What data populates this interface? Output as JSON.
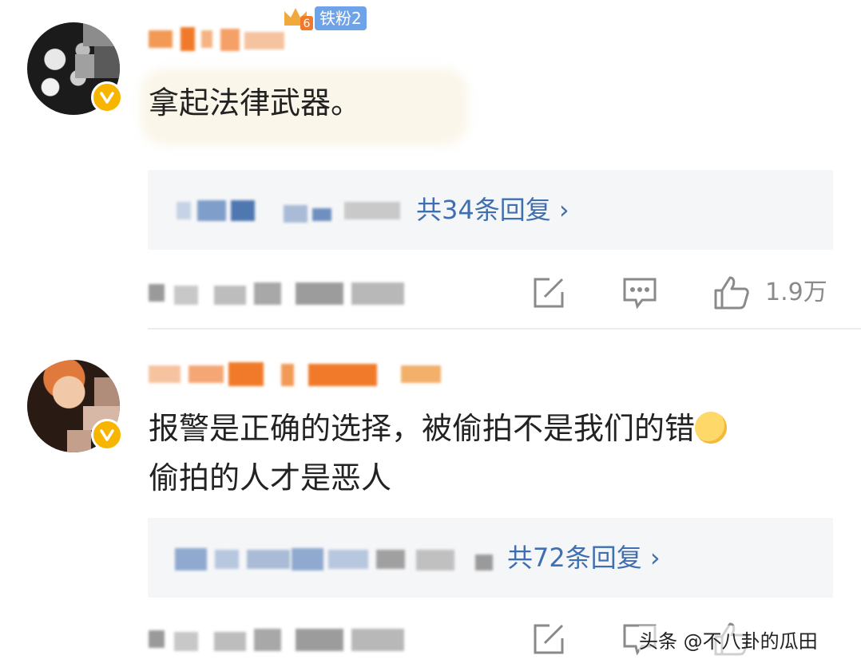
{
  "comments": [
    {
      "fan_badge": "铁粉2",
      "level": "6",
      "text": "拿起法律武器。",
      "reply_summary": "共34条回复 ›",
      "like_count": "1.9万"
    },
    {
      "text_line1": "报警是正确的选择，被偷拍不是我们的错",
      "text_line2": "偷拍的人才是恶人",
      "reply_summary": "共72条回复 ›"
    }
  ],
  "icons": {
    "verified": "verified-badge-icon",
    "share": "share-icon",
    "comment": "comment-icon",
    "like": "thumbs-up-icon",
    "emoji": "thinking-face-emoji"
  },
  "colors": {
    "reply_link": "#3f6fb0",
    "verified_badge": "#f7b500",
    "fan_badge": "#6fa3e8",
    "reply_box_bg": "#f5f6f8",
    "meta_text": "#8a8a8a"
  },
  "watermark": "头条 @不八卦的瓜田"
}
